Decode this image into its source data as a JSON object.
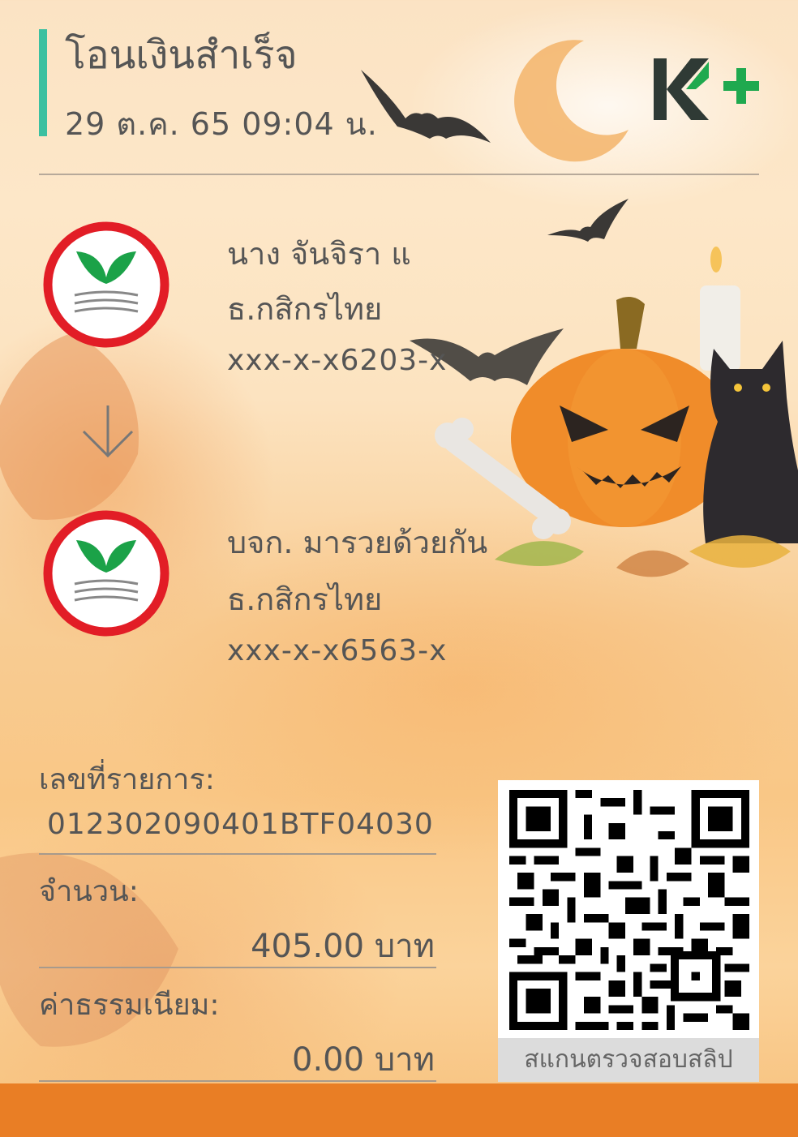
{
  "header": {
    "title": "โอนเงินสำเร็จ",
    "datetime": "29 ต.ค. 65  09:04 น."
  },
  "brand": {
    "logo_text": "K+",
    "logo_icon": "kplus-logo-icon",
    "accent": "#3cc0a0"
  },
  "sender": {
    "name": "นาง จันจิรา แ",
    "bank": "ธ.กสิกรไทย",
    "account": "xxx-x-x6203-x",
    "bank_icon": "kbank-logo-icon"
  },
  "receiver": {
    "name": "บจก. มารวยด้วยกัน",
    "bank": "ธ.กสิกรไทย",
    "account": "xxx-x-x6563-x",
    "bank_icon": "kbank-logo-icon"
  },
  "details": {
    "txid_label": "เลขที่รายการ:",
    "txid_value": "012302090401BTF04030",
    "amount_label": "จำนวน:",
    "amount_value": "405.00 บาท",
    "fee_label": "ค่าธรรมเนียม:",
    "fee_value": "0.00 บาท"
  },
  "qr": {
    "caption": "สแกนตรวจสอบสลิป",
    "icon": "qr-code-icon"
  },
  "colors": {
    "band": "#e97e25",
    "kbank_green": "#1ba248",
    "kbank_red": "#e21d26"
  }
}
